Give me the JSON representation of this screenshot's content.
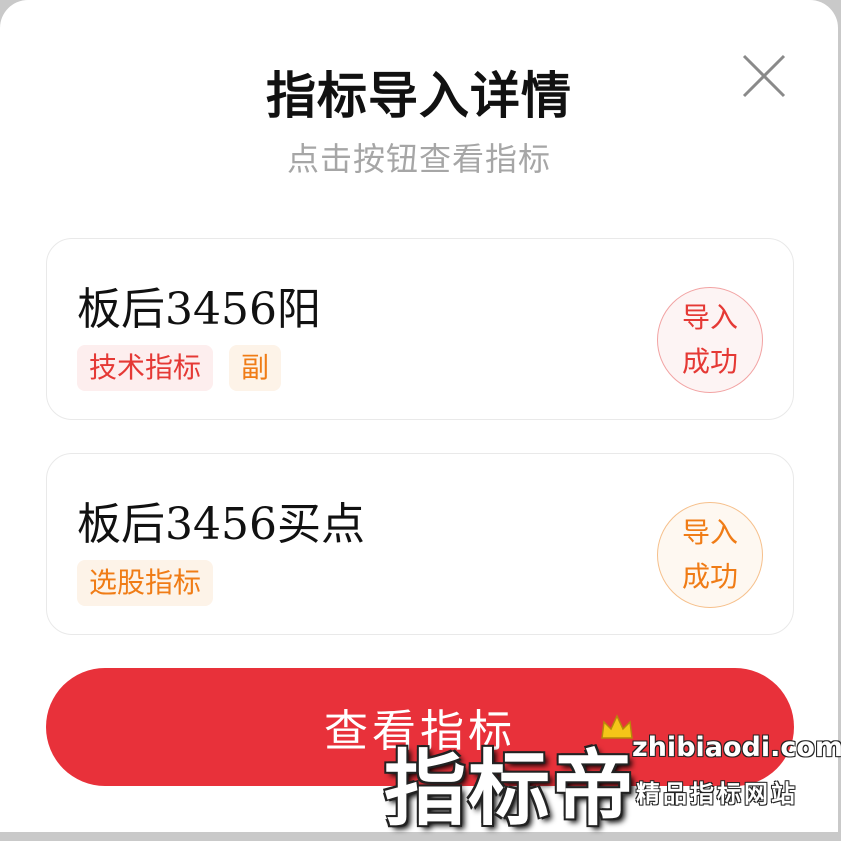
{
  "dialog": {
    "title": "指标导入详情",
    "subtitle": "点击按钮查看指标",
    "close_icon": "close-icon"
  },
  "cards": [
    {
      "name": "板后3456阳",
      "tags": [
        "技术指标",
        "副"
      ],
      "stamp_line1": "导入",
      "stamp_line2": "成功",
      "stamp_color": "#e53935"
    },
    {
      "name": "板后3456买点",
      "tags": [
        "选股指标"
      ],
      "stamp_line1": "导入",
      "stamp_line2": "成功",
      "stamp_color": "#f07c16"
    }
  ],
  "action": {
    "view_label": "查看指标",
    "color": "#e8313a"
  },
  "watermark": {
    "brand": "指标帝",
    "url": "zhibiaodi.com",
    "slogan": "精品指标网站",
    "icon": "crown-icon"
  }
}
